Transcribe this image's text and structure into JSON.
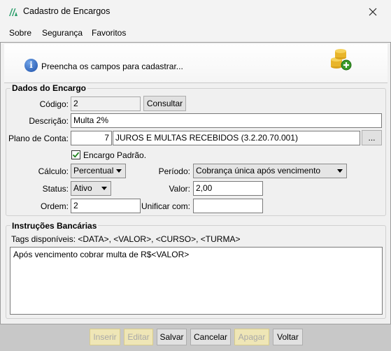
{
  "window": {
    "title": "Cadastro de Encargos"
  },
  "menu": {
    "sobre": "Sobre",
    "seguranca": "Segurança",
    "favoritos": "Favoritos"
  },
  "banner": {
    "text": "Preencha os campos para cadastrar..."
  },
  "dados": {
    "legend": "Dados do Encargo",
    "codigo_label": "Código:",
    "codigo_value": "2",
    "consultar_label": "Consultar",
    "descricao_label": "Descrição:",
    "descricao_value": "Multa 2%",
    "plano_label": "Plano de Conta:",
    "plano_code": "7",
    "plano_desc": "JUROS E MULTAS RECEBIDOS (3.2.20.70.001)",
    "plano_browse": "...",
    "padrao_label": "Encargo Padrão.",
    "padrao_checked": true,
    "calculo_label": "Cálculo:",
    "calculo_value": "Percentual",
    "periodo_label": "Período:",
    "periodo_value": "Cobrança única após vencimento",
    "status_label": "Status:",
    "status_value": "Ativo",
    "valor_label": "Valor:",
    "valor_value": "2,00",
    "ordem_label": "Ordem:",
    "ordem_value": "2",
    "unificar_label": "Unificar com:",
    "unificar_value": ""
  },
  "instrucoes": {
    "legend": "Instruções Bancárias",
    "tags": "Tags disponíveis: <DATA>, <VALOR>, <CURSO>, <TURMA>",
    "text": "Após vencimento cobrar multa de R$<VALOR>"
  },
  "buttons": {
    "inserir": "Inserir",
    "editar": "Editar",
    "salvar": "Salvar",
    "cancelar": "Cancelar",
    "apagar": "Apagar",
    "voltar": "Voltar"
  },
  "colors": {
    "accent": "#1c4fa8",
    "check": "#1a7f1a",
    "bottom_bar": "#c8c8c8"
  }
}
